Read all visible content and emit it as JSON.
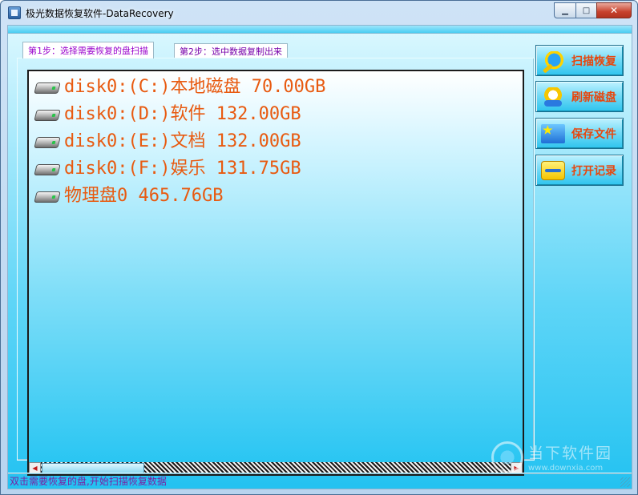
{
  "window": {
    "title": "极光数据恢复软件-DataRecovery",
    "controls": {
      "minimize": "▁",
      "maximize": "□",
      "close": "✕"
    }
  },
  "tabs": [
    {
      "label": "第1步：选择需要恢复的盘扫描",
      "active": true
    },
    {
      "label": "第2步：选中数据复制出来",
      "active": false
    }
  ],
  "disk_list": {
    "items": [
      {
        "label": "disk0:(C:)本地磁盘 70.00GB",
        "icon": "hard-disk-icon"
      },
      {
        "label": "disk0:(D:)软件 132.00GB",
        "icon": "hard-disk-icon"
      },
      {
        "label": "disk0:(E:)文档 132.00GB",
        "icon": "hard-disk-icon"
      },
      {
        "label": "disk0:(F:)娱乐 131.75GB",
        "icon": "hard-disk-icon"
      },
      {
        "label": "物理盘0 465.76GB",
        "icon": "hard-disk-icon"
      }
    ],
    "scrollbar": {
      "left_arrow": "◀",
      "right_arrow": "▶"
    }
  },
  "actions": [
    {
      "label": "扫描恢复",
      "icon": "magnifier-icon"
    },
    {
      "label": "刷新磁盘",
      "icon": "refresh-disk-icon"
    },
    {
      "label": "保存文件",
      "icon": "save-file-icon"
    },
    {
      "label": "打开记录",
      "icon": "open-record-icon"
    }
  ],
  "status": {
    "text": "双击需要恢复的盘,开始扫描恢复数据"
  },
  "watermark": {
    "main": "当下软件园",
    "url": "www.downxia.com"
  },
  "colors": {
    "list_text": "#e85a10",
    "button_text": "#e8460d",
    "status_text": "#7b1fa2",
    "panel_gradient_bottom": "#23c2f1"
  }
}
